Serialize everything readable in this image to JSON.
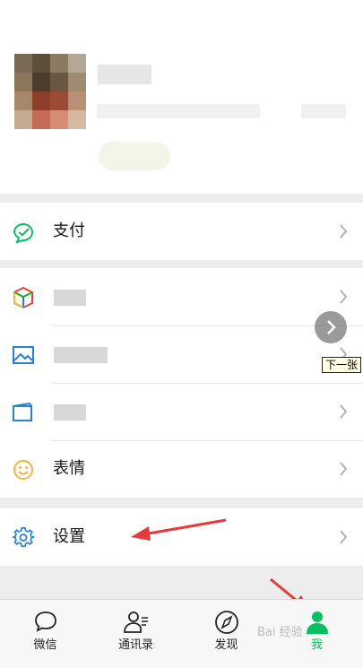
{
  "menu": {
    "pay": "支付",
    "sticker": "表情",
    "settings": "设置"
  },
  "overlay": {
    "next_tooltip": "下一张"
  },
  "tabs": [
    {
      "label": "微信"
    },
    {
      "label": "通讯录"
    },
    {
      "label": "发现"
    },
    {
      "label": "我"
    }
  ],
  "colors": {
    "accent": "#07c160",
    "annotation_arrow": "#e8393b"
  },
  "watermark": "Bai 经验"
}
